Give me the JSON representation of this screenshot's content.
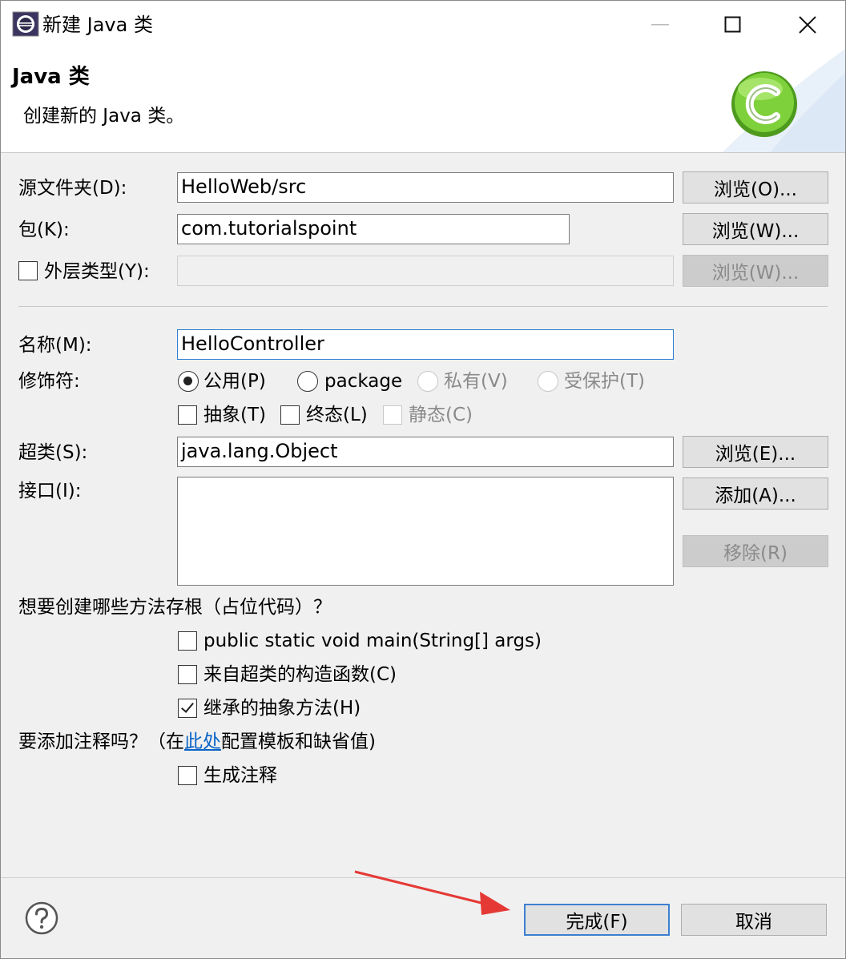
{
  "window": {
    "title": "新建 Java 类"
  },
  "banner": {
    "title": "Java 类",
    "description": "创建新的 Java 类。"
  },
  "source_folder": {
    "label": "源文件夹(D):",
    "value": "HelloWeb/src",
    "browse_label": "浏览(O)..."
  },
  "package": {
    "label": "包(K):",
    "value": "com.tutorialspoint",
    "browse_label": "浏览(W)..."
  },
  "enclosing_type": {
    "label": "外层类型(Y):",
    "value": "",
    "browse_label": "浏览(W)...",
    "checked": false
  },
  "name": {
    "label": "名称(M):",
    "value": "HelloController"
  },
  "modifiers": {
    "label": "修饰符:",
    "access": [
      {
        "label": "公用(P)",
        "selected": true,
        "enabled": true
      },
      {
        "label": "package",
        "selected": false,
        "enabled": true
      },
      {
        "label": "私有(V)",
        "selected": false,
        "enabled": false
      },
      {
        "label": "受保护(T)",
        "selected": false,
        "enabled": false
      }
    ],
    "flags": [
      {
        "label": "抽象(T)",
        "checked": false,
        "enabled": true
      },
      {
        "label": "终态(L)",
        "checked": false,
        "enabled": true
      },
      {
        "label": "静态(C)",
        "checked": false,
        "enabled": false
      }
    ]
  },
  "superclass": {
    "label": "超类(S):",
    "value": "java.lang.Object",
    "browse_label": "浏览(E)..."
  },
  "interfaces": {
    "label": "接口(I):",
    "add_label": "添加(A)...",
    "remove_label": "移除(R)"
  },
  "stubs": {
    "question": "想要创建哪些方法存根（占位代码）？",
    "options": [
      {
        "label": "public static void main(String[] args)",
        "checked": false
      },
      {
        "label": "来自超类的构造函数(C)",
        "checked": false
      },
      {
        "label": "继承的抽象方法(H)",
        "checked": true
      }
    ]
  },
  "comments": {
    "question_prefix": "要添加注释吗？（在",
    "link": "此处",
    "question_suffix": "配置模板和缺省值)",
    "generate_label": "生成注释",
    "checked": false
  },
  "footer": {
    "finish_label": "完成(F)",
    "cancel_label": "取消"
  },
  "colors": {
    "accent": "#3c7fd0",
    "link": "#0b63c5",
    "arrow": "#e53935",
    "logo_green": "#6cc82a"
  }
}
